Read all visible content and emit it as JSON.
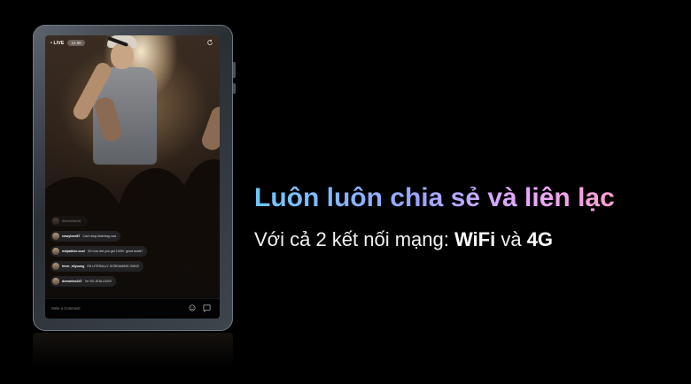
{
  "tablet_screen": {
    "live_label": "• LIVE",
    "viewer_count": "12.6K",
    "comments": [
      {
        "user": "fitnessfan18",
        "text": "",
        "faded": true
      },
      {
        "user": "crazylove87",
        "text": "Can't stop listening now",
        "faded": false
      },
      {
        "user": "notpatrice.cool",
        "text": "Oh how did you get 1000+ good seats?",
        "faded": false
      },
      {
        "user": "fever_ellyoung",
        "text": "I'M LITERALLY SCREAMING OMG!!",
        "faded": false
      },
      {
        "user": "deewrites247",
        "text": "I'm SO JEALOUS!!",
        "faded": false
      }
    ],
    "input_placeholder": "Write a Comment",
    "icons": [
      "refresh-icon",
      "emoji-icon",
      "chat-icon"
    ]
  },
  "headline": "Luôn luôn chia sẻ và liên lạc",
  "subline": {
    "prefix": "Với cả 2 kết nối mạng: ",
    "wifi": "WiFi",
    "connector": " và ",
    "g4": "4G"
  },
  "colors": {
    "background": "#000000",
    "headline_gradient_start": "#6ec8ff",
    "headline_gradient_end": "#ff9fd0",
    "subline": "#f2f2f2"
  }
}
